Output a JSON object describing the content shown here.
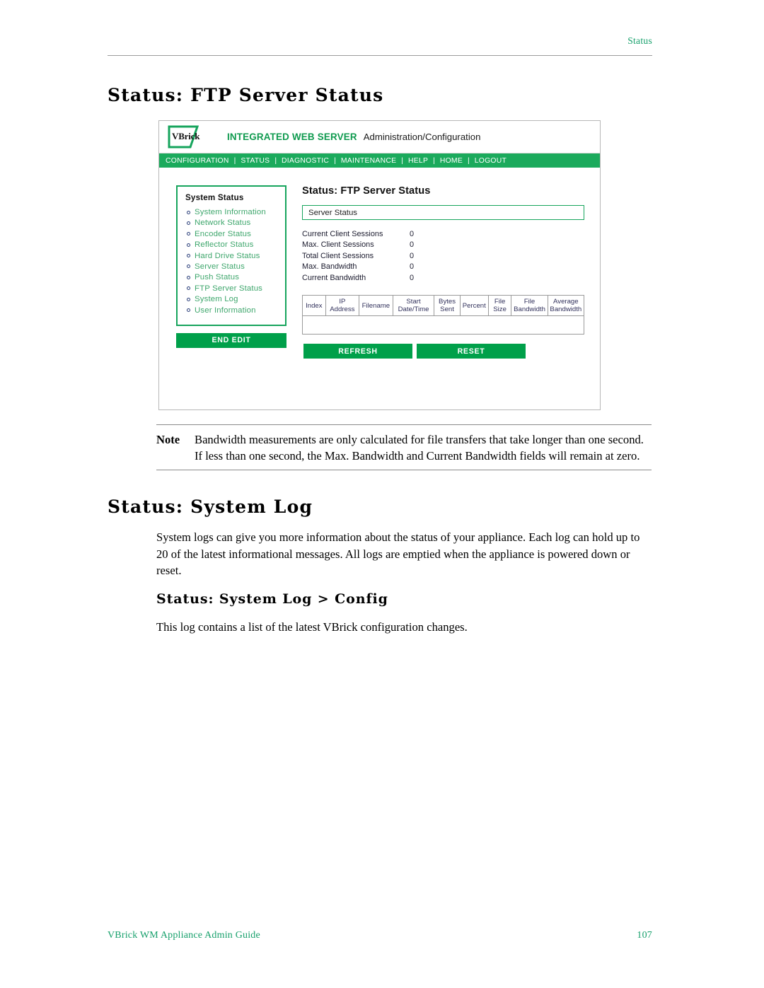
{
  "page": {
    "running_head": "Status",
    "footer_left": "VBrick WM Appliance Admin Guide",
    "footer_right": "107",
    "accent_green": "#16A06B",
    "ui_green": "#00A04A",
    "nav_green": "#1BAA5C"
  },
  "headings": {
    "h1_ftp": "Status: FTP Server Status",
    "h1_syslog": "Status: System Log",
    "h2_syslog_config": "Status: System Log > Config"
  },
  "note": {
    "label": "Note",
    "text": "Bandwidth measurements are only calculated for file transfers that take longer than one second. If less than one second, the Max. Bandwidth and Current Bandwidth fields will remain at zero."
  },
  "paragraphs": {
    "syslog": "System logs can give you more information about the status of your appliance. Each log can hold up to 20 of the latest informational messages. All logs are emptied when the appliance is powered down or reset.",
    "syslog_config": "This log contains a list of the latest VBrick configuration changes."
  },
  "screenshot": {
    "logo_text": "VBrick",
    "header_title": "INTEGRATED WEB SERVER",
    "header_subtitle": "Administration/Configuration",
    "nav_items": [
      "CONFIGURATION",
      "STATUS",
      "DIAGNOSTIC",
      "MAINTENANCE",
      "HELP",
      "HOME",
      "LOGOUT"
    ],
    "nav_separator": "|",
    "sidebar": {
      "title": "System Status",
      "items": [
        {
          "label": "System Information"
        },
        {
          "label": "Network Status"
        },
        {
          "label": "Encoder Status"
        },
        {
          "label": "Reflector Status"
        },
        {
          "label": "Hard Drive Status"
        },
        {
          "label": "Server Status"
        },
        {
          "label": "Push Status"
        },
        {
          "label": "FTP Server Status"
        },
        {
          "label": "System Log"
        },
        {
          "label": "User Information"
        }
      ],
      "end_edit_label": "END EDIT"
    },
    "main": {
      "panel_title": "Status: FTP Server Status",
      "section_bar_label": "Server Status",
      "stats": [
        {
          "key": "Current Client Sessions",
          "value": "0"
        },
        {
          "key": "Max. Client Sessions",
          "value": "0"
        },
        {
          "key": "Total Client Sessions",
          "value": "0"
        },
        {
          "key": "Max. Bandwidth",
          "value": "0"
        },
        {
          "key": "Current Bandwidth",
          "value": "0"
        }
      ],
      "table": {
        "columns": [
          "Index",
          "IP Address",
          "Filename",
          "Start Date/Time",
          "Bytes Sent",
          "Percent",
          "File Size",
          "File Bandwidth",
          "Average Bandwidth"
        ],
        "rows": []
      },
      "buttons": {
        "refresh": "REFRESH",
        "reset": "RESET"
      }
    }
  }
}
